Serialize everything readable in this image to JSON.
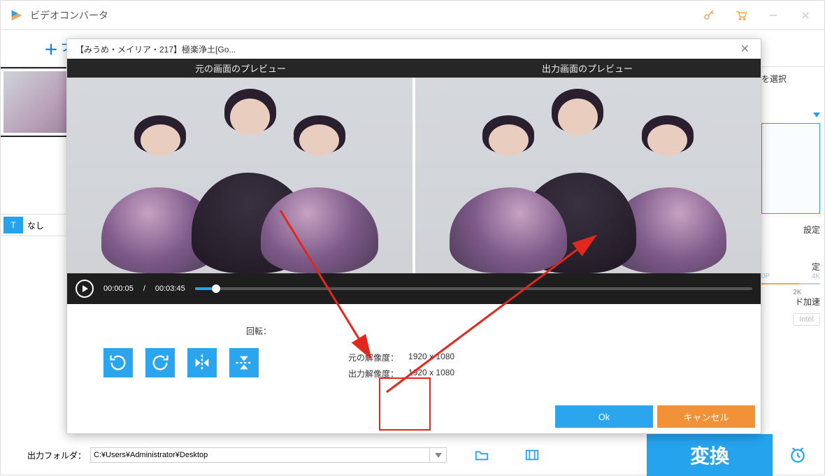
{
  "window": {
    "title": "ビデオコンバータ"
  },
  "toolbar": {
    "add_label": "フ"
  },
  "list": {
    "subtitle_chip": "T",
    "subtitle_text": "なし"
  },
  "right": {
    "select_label": "を選択",
    "settings_label": "設定",
    "preset_label": "定",
    "scale_start": "0P",
    "scale_mid": "2K",
    "scale_end": "4K",
    "accel_label": "ド加速",
    "intel_label": "Intel"
  },
  "bottom": {
    "folder_label": "出力フォルダ：",
    "folder_path": "C:¥Users¥Administrator¥Desktop",
    "convert_label": "変換"
  },
  "modal": {
    "title": "【みうめ・メイリア・217】極楽浄土[Go...",
    "original_header": "元の画面のプレビュー",
    "output_header": "出力画面のプレビュー",
    "time_current": "00:00:05",
    "time_sep": "/",
    "time_total": "00:03:45",
    "rotate_label": "回転：",
    "orig_res_label": "元の解像度：",
    "orig_res_value": "1920 x 1080",
    "out_res_label": "出力解像度：",
    "out_res_value": "1920 x 1080",
    "ok_label": "Ok",
    "cancel_label": "キャンセル"
  }
}
